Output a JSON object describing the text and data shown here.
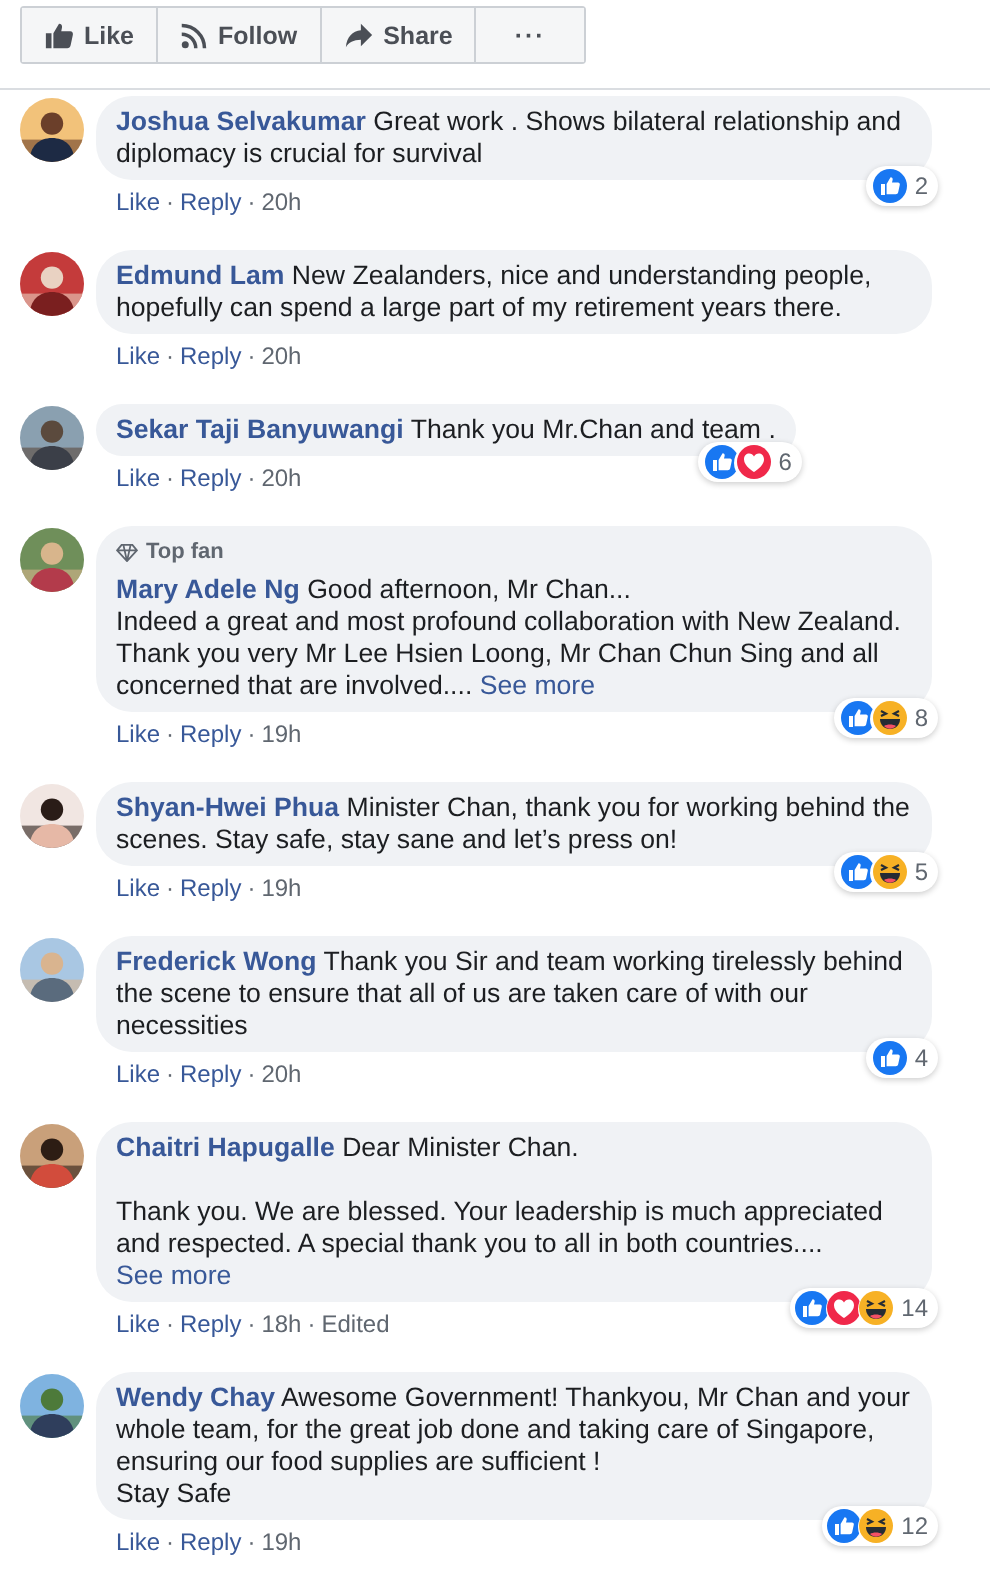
{
  "toolbar": [
    {
      "kind": "like",
      "label": "Like"
    },
    {
      "kind": "follow",
      "label": "Follow"
    },
    {
      "kind": "share",
      "label": "Share"
    },
    {
      "kind": "more",
      "label": "···"
    }
  ],
  "separator": "·",
  "comments": [
    {
      "author": "Joshua Selvakumar",
      "blocks": [
        [
          "Great work . Shows bilateral relationship and diplomacy is crucial for survival"
        ]
      ],
      "actions": [
        "Like",
        "Reply"
      ],
      "time": "20h",
      "reactions": {
        "icons": [
          {
            "kind": "like"
          }
        ],
        "count": "2"
      }
    },
    {
      "author": "Edmund Lam",
      "blocks": [
        [
          "New Zealanders, nice and understanding people, hopefully can spend a large part of my retirement years there."
        ]
      ],
      "actions": [
        "Like",
        "Reply"
      ],
      "time": "20h"
    },
    {
      "author": "Sekar Taji Banyuwangi",
      "blocks": [
        [
          "Thank you Mr.Chan and team ."
        ]
      ],
      "actions": [
        "Like",
        "Reply"
      ],
      "time": "20h",
      "reactions": {
        "icons": [
          {
            "kind": "like"
          },
          {
            "kind": "love"
          }
        ],
        "count": "6"
      }
    },
    {
      "author": "Mary Adele Ng",
      "badge": "Top fan",
      "blocks": [
        [
          "Good afternoon, Mr Chan...",
          "Indeed a great and most profound collaboration with New Zealand.",
          "Thank you very Mr Lee Hsien Loong, Mr Chan Chun Sing and all concerned that are involved...."
        ]
      ],
      "see_more": "See more",
      "actions": [
        "Like",
        "Reply"
      ],
      "time": "19h",
      "reactions": {
        "icons": [
          {
            "kind": "like"
          },
          {
            "kind": "haha"
          }
        ],
        "count": "8"
      }
    },
    {
      "author": "Shyan-Hwei Phua",
      "blocks": [
        [
          "Minister Chan, thank you for working behind the scenes. Stay safe, stay sane and let’s press on!"
        ]
      ],
      "actions": [
        "Like",
        "Reply"
      ],
      "time": "19h",
      "reactions": {
        "icons": [
          {
            "kind": "like"
          },
          {
            "kind": "haha"
          }
        ],
        "count": "5"
      }
    },
    {
      "author": "Frederick Wong",
      "blocks": [
        [
          "Thank you Sir and team working tirelessly behind the scene to ensure that all of us are taken care of with our necessities"
        ]
      ],
      "actions": [
        "Like",
        "Reply"
      ],
      "time": "20h",
      "reactions": {
        "icons": [
          {
            "kind": "like"
          }
        ],
        "count": "4"
      }
    },
    {
      "author": "Chaitri Hapugalle",
      "blocks": [
        [
          "Dear Minister Chan."
        ],
        [
          "Thank you. We are blessed. Your leadership is much appreciated and respected. A special thank you to all in both countries...."
        ]
      ],
      "see_more": "See more",
      "actions": [
        "Like",
        "Reply"
      ],
      "time": "18h",
      "edited": "Edited",
      "reactions": {
        "icons": [
          {
            "kind": "like"
          },
          {
            "kind": "love"
          },
          {
            "kind": "haha"
          }
        ],
        "count": "14"
      }
    },
    {
      "author": "Wendy Chay",
      "blocks": [
        [
          "Awesome Government! Thankyou, Mr Chan and your whole team, for the great job done and taking care of Singapore, ensuring our food supplies are sufficient !",
          "Stay Safe"
        ]
      ],
      "actions": [
        "Like",
        "Reply"
      ],
      "time": "19h",
      "reactions": {
        "icons": [
          {
            "kind": "like"
          },
          {
            "kind": "haha"
          }
        ],
        "count": "12"
      }
    }
  ]
}
